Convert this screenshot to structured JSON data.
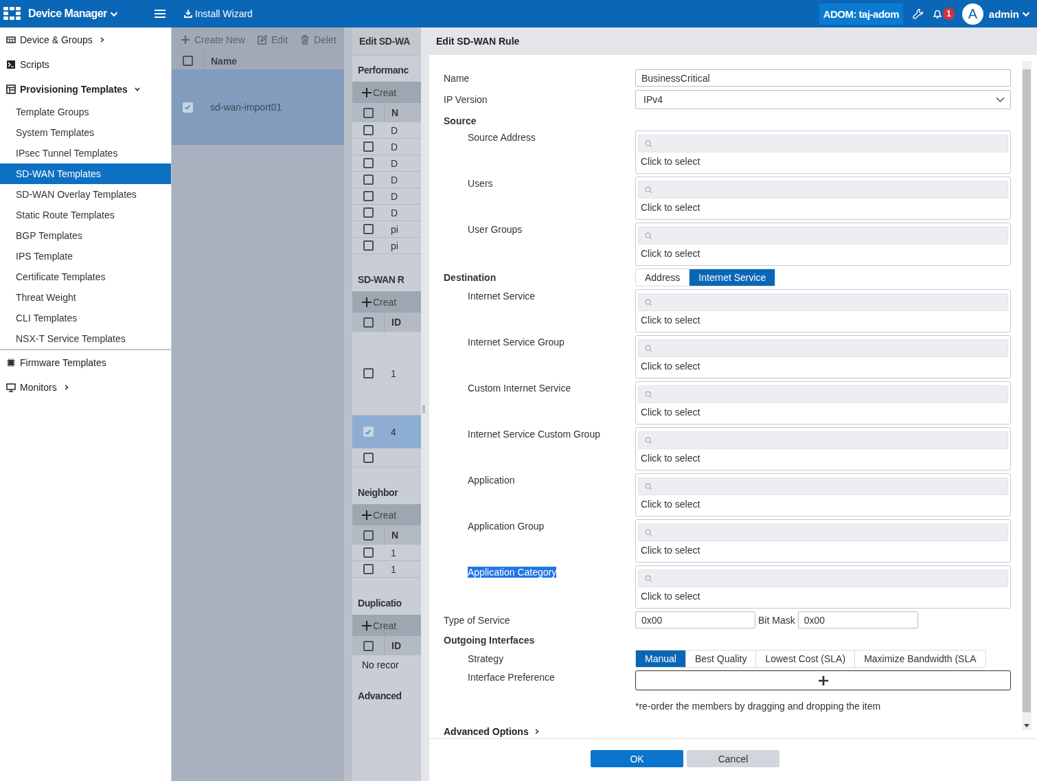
{
  "top_bar": {
    "app_title": "Device Manager",
    "menu_link": "Install Wizard",
    "adom": "ADOM: taj-adom",
    "notification_count": "1",
    "avatar_letter": "A",
    "user": "admin"
  },
  "sidebar": {
    "items": [
      {
        "label": "Device & Groups",
        "kind": "group",
        "expanded": false,
        "selected": false
      },
      {
        "label": "Scripts",
        "kind": "link",
        "selected": false
      },
      {
        "label": "Provisioning Templates",
        "kind": "group",
        "expanded": true,
        "selected": false,
        "children": [
          {
            "label": "Template Groups",
            "selected": false
          },
          {
            "label": "System Templates",
            "selected": false
          },
          {
            "label": "IPsec Tunnel Templates",
            "selected": false
          },
          {
            "label": "SD-WAN Templates",
            "selected": true
          },
          {
            "label": "SD-WAN Overlay Templates",
            "selected": false
          },
          {
            "label": "Static Route Templates",
            "selected": false
          },
          {
            "label": "BGP Templates",
            "selected": false
          },
          {
            "label": "IPS Template",
            "selected": false
          },
          {
            "label": "Certificate Templates",
            "selected": false
          },
          {
            "label": "Threat Weight",
            "selected": false
          },
          {
            "label": "CLI Templates",
            "selected": false
          },
          {
            "label": "NSX-T Service Templates",
            "selected": false
          }
        ]
      },
      {
        "label": "Firmware Templates",
        "kind": "link",
        "selected": false
      },
      {
        "label": "Monitors",
        "kind": "group",
        "expanded": false,
        "selected": false
      }
    ]
  },
  "template_list": {
    "toolbar": [
      "Create New",
      "Edit",
      "Delet"
    ],
    "column": "Name",
    "all_checked": false,
    "rows": [
      {
        "name": "sd-wan-import01",
        "checked": true,
        "selected": true
      }
    ]
  },
  "template_editor": {
    "title": "Edit SD-WA",
    "sections": [
      {
        "title": "Performanc",
        "toolbar": "Creat",
        "column": "N",
        "all_checked": false,
        "rows": [
          {
            "cell": "D",
            "checked": false,
            "selected": false
          },
          {
            "cell": "D",
            "checked": false,
            "selected": false
          },
          {
            "cell": "D",
            "checked": false,
            "selected": false
          },
          {
            "cell": "D",
            "checked": false,
            "selected": false
          },
          {
            "cell": "D",
            "checked": false,
            "selected": false
          },
          {
            "cell": "D",
            "checked": false,
            "selected": false
          },
          {
            "cell": "pi",
            "checked": false,
            "selected": false
          },
          {
            "cell": "pi",
            "checked": false,
            "selected": false
          }
        ]
      },
      {
        "title": "SD-WAN R",
        "toolbar": "Creat",
        "column": "ID",
        "all_checked": false,
        "rows": [
          {
            "cell": "1",
            "checked": false,
            "selected": false
          },
          {
            "cell": "4",
            "checked": true,
            "selected": true
          },
          {
            "checked": false,
            "selected": false
          }
        ]
      },
      {
        "title": "Neighbor",
        "toolbar": "Creat",
        "column": "N",
        "all_checked": false,
        "rows": [
          {
            "cell": "1",
            "checked": false,
            "selected": false
          },
          {
            "cell": "1",
            "checked": false,
            "selected": false
          }
        ]
      },
      {
        "title": "Duplicatio",
        "toolbar": "Creat",
        "column": "ID",
        "all_checked": false,
        "empty_text": "No recor"
      },
      {
        "title": "Advanced"
      }
    ]
  },
  "rule_dialog": {
    "title": "Edit SD-WAN Rule",
    "fields": [
      {
        "kind": "text",
        "label": "Name",
        "value": "BusinessCritical"
      },
      {
        "kind": "select",
        "label": "IP Version",
        "value": "IPv4"
      },
      {
        "kind": "heading",
        "label": "Source"
      },
      {
        "kind": "picker",
        "label": "Source Address",
        "prompt": "Click to select",
        "highlighted": false
      },
      {
        "kind": "picker",
        "label": "Users",
        "prompt": "Click to select",
        "highlighted": false
      },
      {
        "kind": "picker",
        "label": "User Groups",
        "prompt": "Click to select",
        "highlighted": false
      },
      {
        "kind": "switch",
        "label": "Destination",
        "options": [
          {
            "label": "Address",
            "selected": false
          },
          {
            "label": "Internet Service",
            "selected": true
          }
        ]
      },
      {
        "kind": "picker",
        "label": "Internet Service",
        "prompt": "Click to select",
        "highlighted": false
      },
      {
        "kind": "picker",
        "label": "Internet Service Group",
        "prompt": "Click to select",
        "highlighted": false
      },
      {
        "kind": "picker",
        "label": "Custom Internet Service",
        "prompt": "Click to select",
        "highlighted": false
      },
      {
        "kind": "picker",
        "label": "Internet Service Custom Group",
        "prompt": "Click to select",
        "highlighted": false
      },
      {
        "kind": "picker",
        "label": "Application",
        "prompt": "Click to select",
        "highlighted": false
      },
      {
        "kind": "picker",
        "label": "Application Group",
        "prompt": "Click to select",
        "highlighted": false
      },
      {
        "kind": "picker",
        "label": "Application Category",
        "prompt": "Click to select",
        "highlighted": true
      },
      {
        "kind": "hex",
        "label": "Type of Service",
        "value": "0x00",
        "mask_label": "Bit Mask",
        "mask_value": "0x00"
      },
      {
        "kind": "heading",
        "label": "Outgoing Interfaces"
      },
      {
        "kind": "strategy",
        "label": "Strategy",
        "options": [
          {
            "label": "Manual",
            "selected": true
          },
          {
            "label": "Best Quality",
            "selected": false
          },
          {
            "label": "Lowest Cost (SLA)",
            "selected": false
          },
          {
            "label": "Maximize Bandwidth (SLA",
            "selected": false
          }
        ]
      },
      {
        "kind": "add",
        "label": "Interface Preference",
        "note": "*re-order the members by dragging and dropping the item"
      },
      {
        "kind": "expander",
        "label": "Advanced Options",
        "expanded": false
      }
    ],
    "buttons": [
      {
        "label": "OK",
        "kind": "primary"
      },
      {
        "label": "Cancel",
        "kind": "secondary"
      }
    ]
  }
}
